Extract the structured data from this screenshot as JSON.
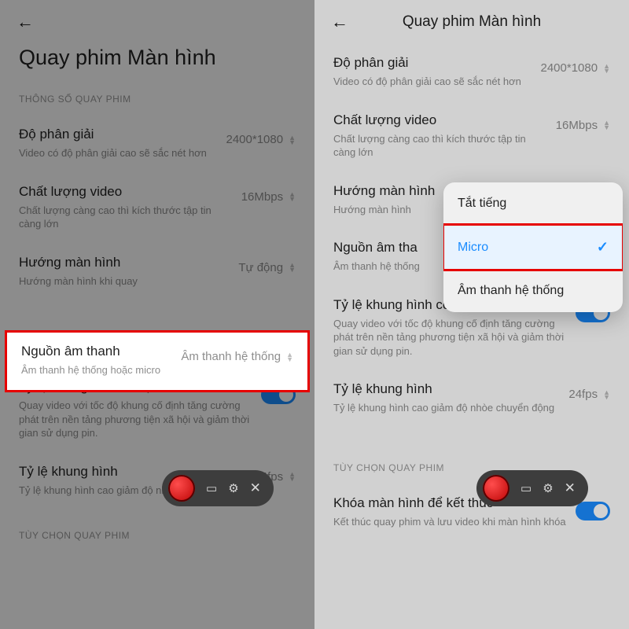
{
  "left": {
    "page_title": "Quay phim Màn hình",
    "section_label": "THÔNG SỐ QUAY PHIM",
    "rows": {
      "resolution": {
        "title": "Độ phân giải",
        "desc": "Video có độ phân giải cao sẽ sắc nét hơn",
        "value": "2400*1080"
      },
      "quality": {
        "title": "Chất lượng video",
        "desc": "Chất lượng càng cao thì kích thước tập tin càng lớn",
        "value": "16Mbps"
      },
      "orientation": {
        "title": "Hướng màn hình",
        "desc": "Hướng màn hình khi quay",
        "value": "Tự động"
      },
      "audio": {
        "title": "Nguồn âm thanh",
        "desc": "Âm thanh hệ thống hoặc micro",
        "value": "Âm thanh hệ thống"
      },
      "fixed_fps": {
        "title": "Tỷ lệ khung hình cố định",
        "desc": "Quay video với tốc độ khung cố định tăng cường phát trên nền tảng phương tiện xã hội và giảm thời gian sử dụng pin."
      },
      "fps": {
        "title": "Tỷ lệ khung hình",
        "desc": "Tỷ lệ khung hình cao giảm độ nhòe chuyển động",
        "value": "24fps"
      }
    },
    "section_label2": "TÙY CHỌN QUAY PHIM"
  },
  "right": {
    "header_title": "Quay phim Màn hình",
    "rows": {
      "resolution": {
        "title": "Độ phân giải",
        "desc": "Video có độ phân giải cao sẽ sắc nét hơn",
        "value": "2400*1080"
      },
      "quality": {
        "title": "Chất lượng video",
        "desc": "Chất lượng càng cao thì kích thước tập tin càng lớn",
        "value": "16Mbps"
      },
      "orientation": {
        "title": "Hướng màn hình",
        "desc": "Hướng màn hình"
      },
      "audio": {
        "title": "Nguồn âm tha",
        "desc": "Âm thanh hệ thống"
      },
      "fixed_fps": {
        "title": "Tỷ lệ khung hình cố định",
        "desc": "Quay video với tốc độ khung cố định tăng cường phát trên nền tảng phương tiện xã hội và giảm thời gian sử dụng pin."
      },
      "fps": {
        "title": "Tỷ lệ khung hình",
        "desc": "Tỷ lệ khung hình cao giảm độ nhòe chuyển động",
        "value": "24fps"
      },
      "lock": {
        "title": "Khóa màn hình để kết thúc",
        "desc": "Kết thúc quay phim và lưu video khi màn hình khóa"
      }
    },
    "popup": {
      "mute": "Tắt tiếng",
      "micro": "Micro",
      "system": "Âm thanh hệ thống"
    },
    "section_label2": "TÙY CHỌN QUAY PHIM"
  }
}
